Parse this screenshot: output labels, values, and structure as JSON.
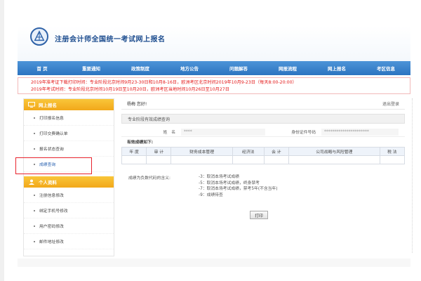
{
  "site_title": "注册会计师全国统一考试网上报名",
  "nav": [
    "首 页",
    "重要通知",
    "政策制度",
    "地方公告",
    "问题解答",
    "网报流程",
    "网上报名",
    "考区信息"
  ],
  "notices": [
    "2019年准考证下载打印时间：专业阶段北京时间9月23-30日和10月8-16日，欧洲考区北京时间2019年10月9-23日（每天8:00-20:00）",
    "2019年考试时间：专业阶段北京时间10月19日至10月20日，欧洲考区当地时间10月26日至10月27日"
  ],
  "sidebar": {
    "section1_title": "网上报名",
    "section1_items": [
      "打印报名信息",
      "打印交费确认单",
      "报名状态查询",
      "成绩查询"
    ],
    "section2_title": "个人资料",
    "section2_items": [
      "注册信息修改",
      "绑定手机号修改",
      "用户密码修改",
      "邮件地址修改"
    ]
  },
  "main": {
    "greeting": "杨梅 您好!",
    "logout": "退出登录",
    "section_title": "专业阶段有效成绩查询",
    "name_label": "姓　名",
    "name_value": "****",
    "id_label": "身份证件号码",
    "id_value": "**********************",
    "grades_label": "有效成绩如下:",
    "grade_headers": [
      "年 度",
      "审 计",
      "财务成本管理",
      "经济法",
      "会 计",
      "公司战略与风险管理",
      "税 法"
    ],
    "legend_title": "成绩为负数代码的含义:",
    "legend_items": [
      "-3：取消本场考试成绩",
      "-5：取消本场考试成绩，终身禁考",
      "-7：取消本场考试成绩，禁考5年(不含当年)",
      "-9：成绩待查"
    ],
    "print_button": "打印"
  }
}
